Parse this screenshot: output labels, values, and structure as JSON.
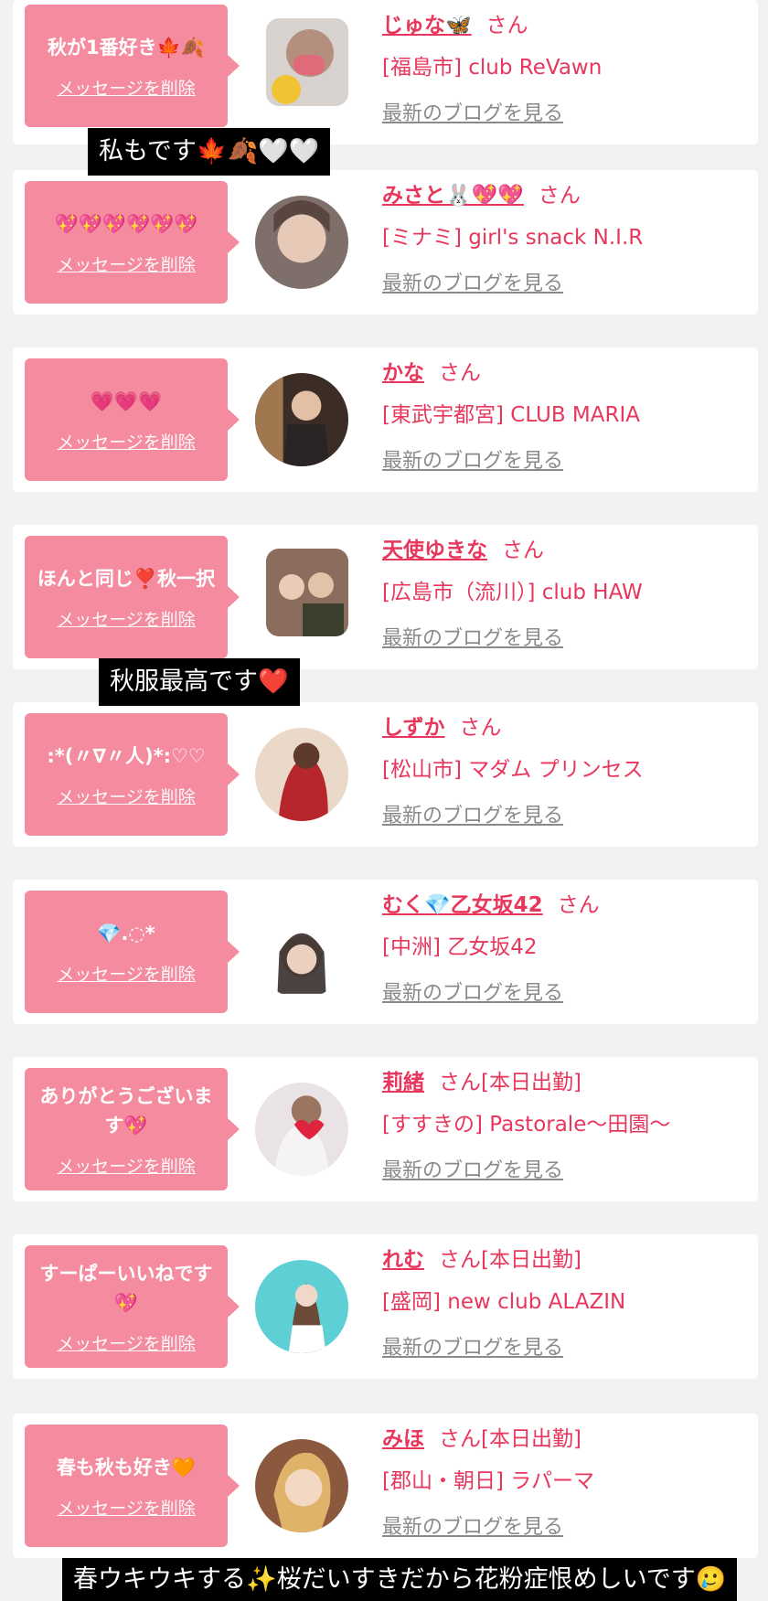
{
  "common": {
    "delete_label": "メッセージを削除",
    "blog_label": "最新のブログを見る",
    "san": "さん"
  },
  "items": [
    {
      "message": "秋が1番好き🍁🍂",
      "name": "じゅな🦋",
      "suffix": "さん",
      "shop": "[福島市] club ReVawn"
    },
    {
      "message": "💖💖💖💖💖💖",
      "name": "みさと🐰💖💖",
      "suffix": "さん",
      "shop": "[ミナミ] girl's snack N.I.R"
    },
    {
      "message": "💗💗💗",
      "name": "かな",
      "suffix": "さん",
      "shop": "[東武宇都宮] CLUB MARIA"
    },
    {
      "message": "ほんと同じ❣️秋一択",
      "name": "天使ゆきな",
      "suffix": "さん",
      "shop": "[広島市（流川）] club HAW"
    },
    {
      "message": ":*(〃∇〃人)*:♡♡",
      "name": "しずか",
      "suffix": "さん",
      "shop": "[松山市] マダム プリンセス"
    },
    {
      "message": "💎.◌*",
      "name": "むく💎乙女坂42",
      "suffix": "さん",
      "shop": "[中洲] 乙女坂42"
    },
    {
      "message": "ありがとうございます💖",
      "name": "莉緒",
      "suffix": "さん[本日出勤]",
      "shop": "[すすきの] Pastorale〜田園〜"
    },
    {
      "message": "すーぱーいいねです💖",
      "name": "れむ",
      "suffix": "さん[本日出勤]",
      "shop": "[盛岡] new club ALAZIN"
    },
    {
      "message": "春も秋も好き🧡",
      "name": "みほ",
      "suffix": "さん[本日出勤]",
      "shop": "[郡山・朝日] ラパーマ"
    }
  ],
  "overlays": {
    "caption1": "私もです🍁🍂🤍🤍",
    "caption2": "秋服最高です❤️",
    "caption3": "春ウキウキする✨桜だいすきだから花粉症恨めしいです🥲"
  },
  "colors": {
    "bubble": "#f48b9f",
    "accent": "#e8375c",
    "link_gray": "#8a8a8a"
  }
}
